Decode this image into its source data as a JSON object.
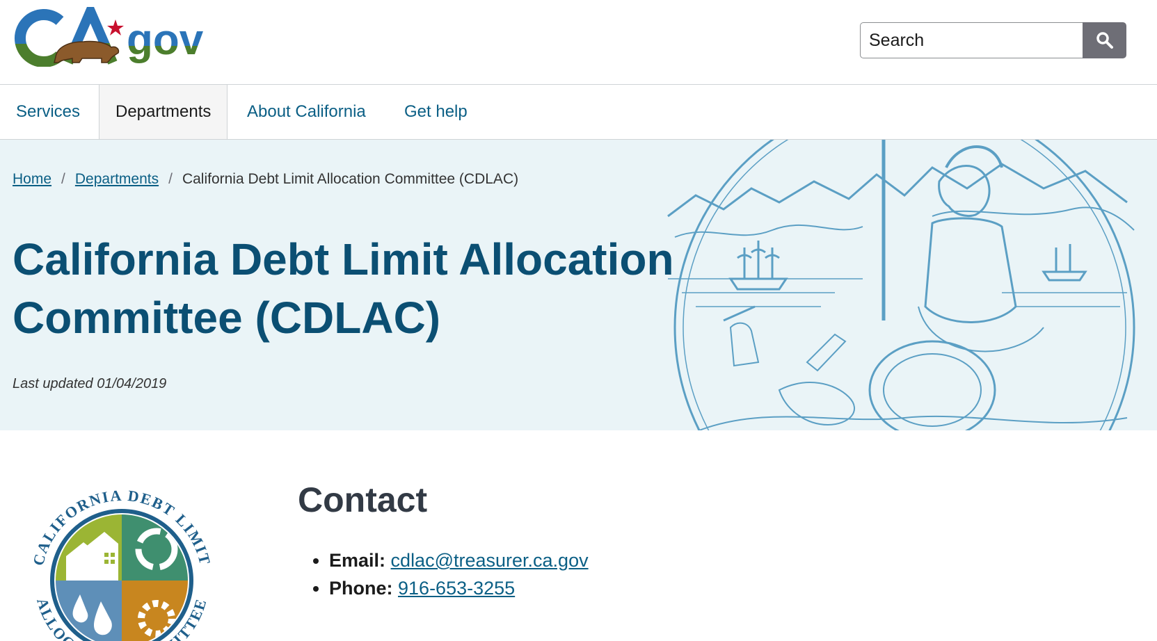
{
  "header": {
    "logo_text_ca": "CA",
    "logo_text_gov": "gov",
    "search": {
      "placeholder": "Search"
    }
  },
  "nav": {
    "items": [
      {
        "label": "Services",
        "active": false
      },
      {
        "label": "Departments",
        "active": true
      },
      {
        "label": "About California",
        "active": false
      },
      {
        "label": "Get help",
        "active": false
      }
    ]
  },
  "breadcrumb": {
    "home": "Home",
    "departments": "Departments",
    "current": "California Debt Limit Allocation Committee (CDLAC)"
  },
  "hero": {
    "title": "California Debt Limit Allocation Committee (CDLAC)",
    "last_updated": "Last updated 01/04/2019"
  },
  "cdlac_logo": {
    "ring_text_top": "CALIFORNIA DEBT LIMIT",
    "ring_text_bottom": "ALLOCATION COMMITTEE"
  },
  "contact": {
    "heading": "Contact",
    "email_label": "Email:",
    "email": "cdlac@treasurer.ca.gov",
    "phone_label": "Phone:",
    "phone": "916-653-3255"
  },
  "colors": {
    "link": "#0b5f85",
    "title": "#0b4f73",
    "hero_bg": "#eaf4f7",
    "seal": "#5b9fc4",
    "search_button": "#6e6e76"
  }
}
